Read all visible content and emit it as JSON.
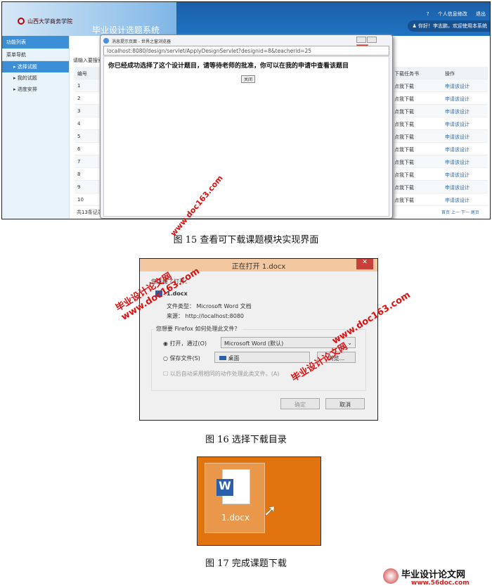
{
  "fig15": {
    "school_name": "山西大学商务学院",
    "system_title": "毕业设计选题系统",
    "top_links": [
      "?",
      "个人信息修改",
      "退出"
    ],
    "welcome": "你好！李志鹏，欢迎使用本系统",
    "sidebar": {
      "header": "功能列表",
      "section": "菜单导航",
      "items": [
        "选择试题",
        "我的试题",
        "进度安排"
      ]
    },
    "search_hint": "请输入要搜索的",
    "table": {
      "headers": [
        "编号",
        "下载任务书",
        "操作"
      ],
      "rows": [
        "1",
        "2",
        "3",
        "4",
        "5",
        "6",
        "7",
        "8",
        "9",
        "10"
      ],
      "download_label": "点我下载",
      "action_label": "申请该设计"
    },
    "footer_count": "共13条记录",
    "pager": [
      "首页",
      "上一",
      "下一",
      "尾页"
    ],
    "popup": {
      "title": "消息提示页面 - 世界之窗浏览器",
      "url": "localhost:8080/design/servlet/ApplyDesignServlet?designid=8&teacherid=25",
      "message": "你已经成功选择了这个设计题目，请等待老师的批准，你可以在我的申请中查看该题目",
      "close": "关闭"
    },
    "caption": "图 15  查看可下载课题模块实现界面"
  },
  "fig16": {
    "title": "正在打开 1.docx",
    "chosen": "您选择了打开：",
    "filename": "1.docx",
    "filetype": "文件类型： Microsoft Word 文档",
    "source": "来源： http://localhost:8080",
    "question": "您想要 Firefox 如何处理此文件？",
    "open_with": "打开，通过(O)",
    "open_app": "Microsoft Word (默认)",
    "save_file": "保存文件(S)",
    "save_location": "桌面",
    "browse": "浏览...",
    "auto": "以后自动采用相同的动作处理此类文件。(A)",
    "ok": "确定",
    "cancel": "取消",
    "caption": "图 16   选择下载目录"
  },
  "fig17": {
    "filename": "1.docx",
    "caption": "图 17   完成课题下载"
  },
  "watermark": {
    "site": "毕业设计论文网",
    "url": "www.doc163.com",
    "footer_site": "毕业设计论文网",
    "footer_url": "www.56doc.com"
  }
}
